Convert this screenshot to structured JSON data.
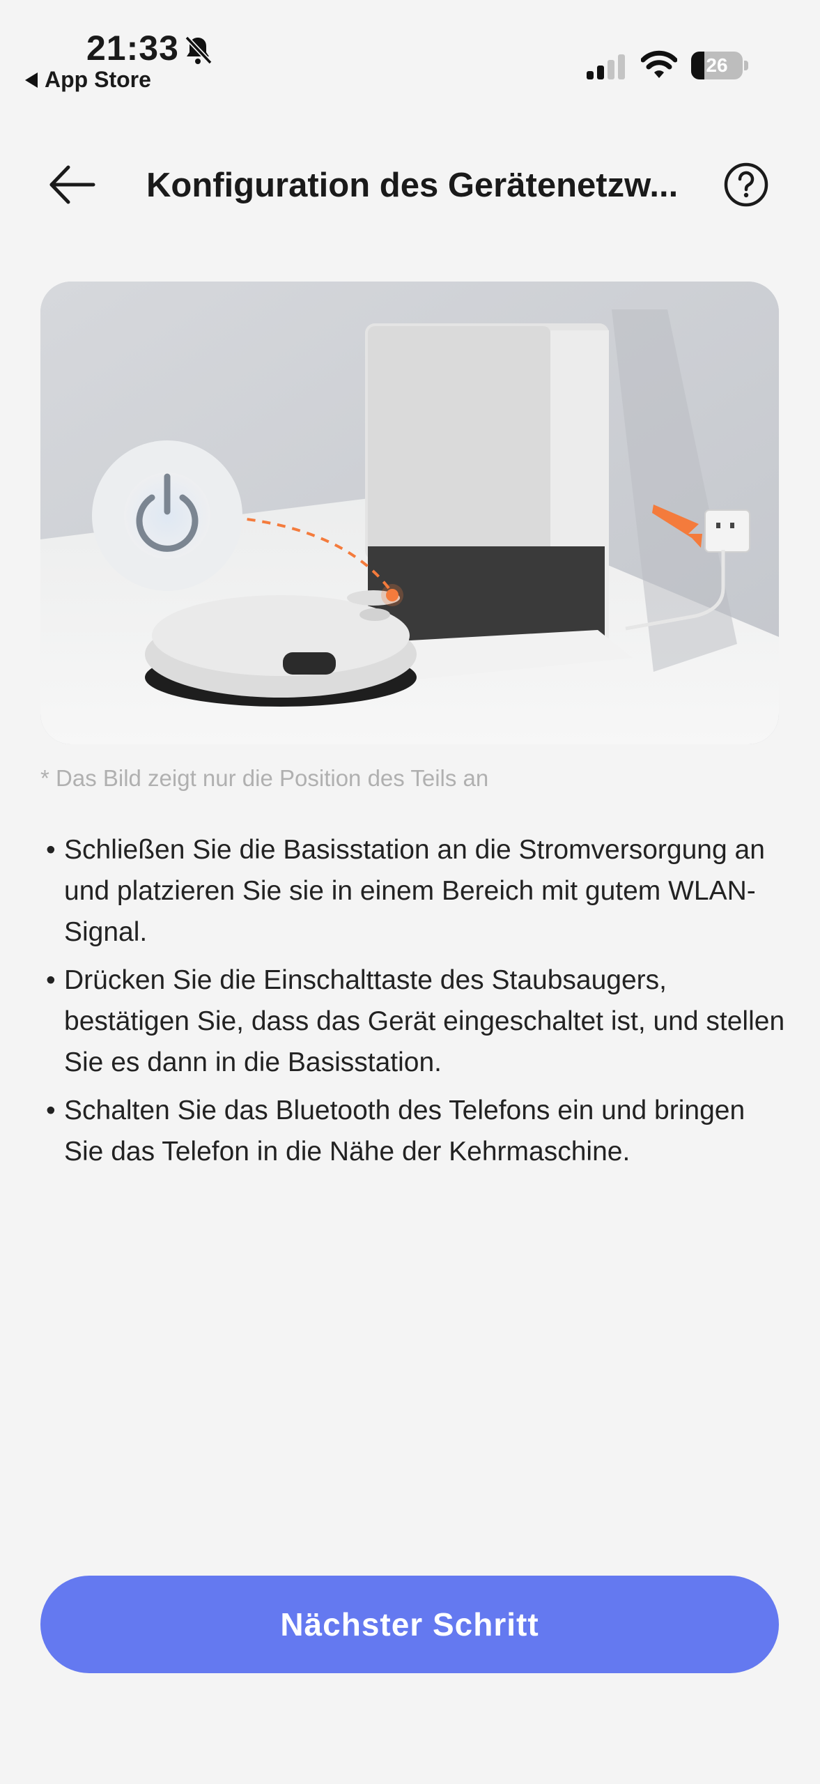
{
  "status_bar": {
    "time": "21:33",
    "back_app": "App Store",
    "battery": "26",
    "battery_level": 0.26
  },
  "header": {
    "title": "Konfiguration des Gerätenetzw..."
  },
  "caption": "* Das Bild zeigt nur die Position des Teils an",
  "steps": [
    "Schließen Sie die Basisstation an die Stromversorgung an und platzieren Sie sie in einem Bereich mit gutem WLAN-Signal.",
    "Drücken Sie die Einschalttaste des Staubsaugers, bestätigen Sie, dass das Gerät eingeschaltet ist, und stellen Sie es dann in die Basisstation.",
    "Schalten Sie das Bluetooth des Telefons ein und bringen Sie das Telefon in die Nähe der Kehrmaschine."
  ],
  "next_button": "Nächster Schritt",
  "colors": {
    "accent": "#6479f0",
    "arrow": "#f47b3c",
    "background": "#f4f4f4"
  }
}
